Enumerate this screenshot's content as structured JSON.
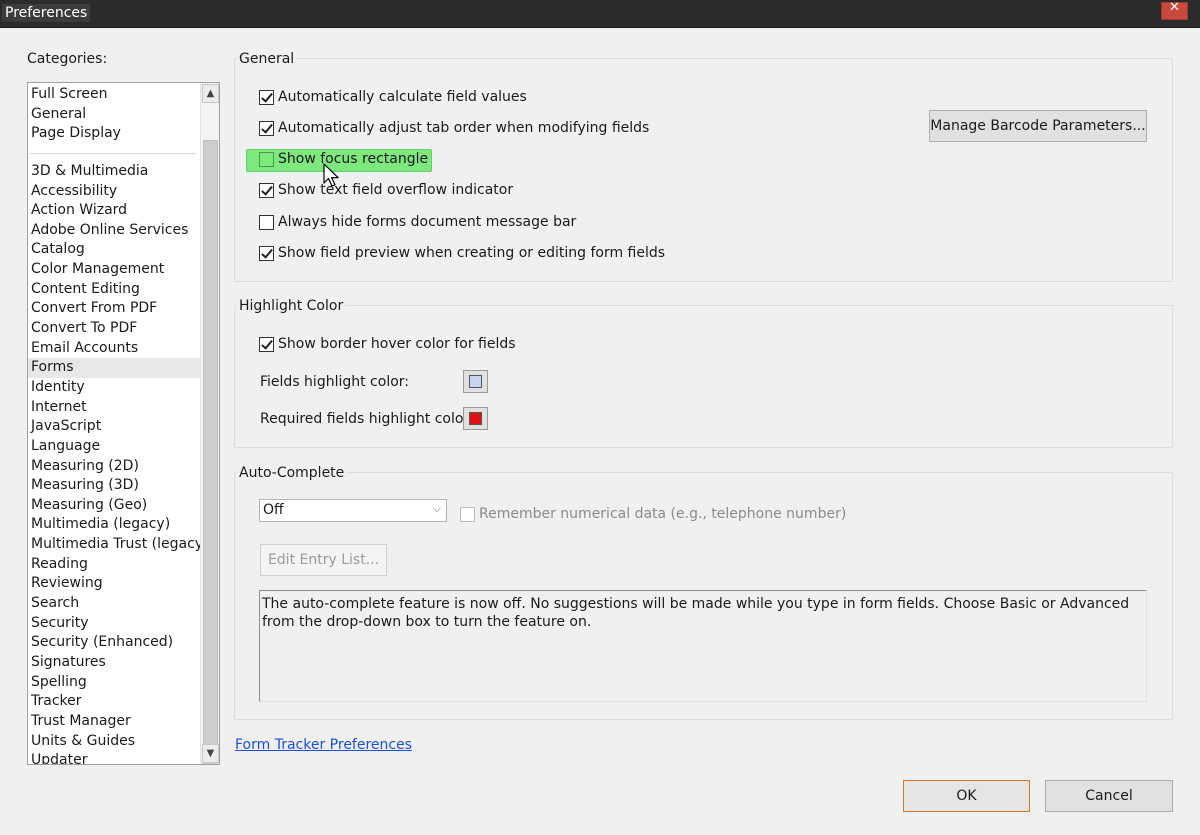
{
  "window": {
    "title": "Preferences",
    "close_glyph": "✕"
  },
  "categories": {
    "label": "Categories:",
    "top_items": [
      "Full Screen",
      "General",
      "Page Display"
    ],
    "items": [
      "3D & Multimedia",
      "Accessibility",
      "Action Wizard",
      "Adobe Online Services",
      "Catalog",
      "Color Management",
      "Content Editing",
      "Convert From PDF",
      "Convert To PDF",
      "Email Accounts",
      "Forms",
      "Identity",
      "Internet",
      "JavaScript",
      "Language",
      "Measuring (2D)",
      "Measuring (3D)",
      "Measuring (Geo)",
      "Multimedia (legacy)",
      "Multimedia Trust (legacy)",
      "Reading",
      "Reviewing",
      "Search",
      "Security",
      "Security (Enhanced)",
      "Signatures",
      "Spelling",
      "Tracker",
      "Trust Manager",
      "Units & Guides",
      "Updater"
    ],
    "selected": "Forms"
  },
  "general": {
    "title": "General",
    "options": [
      {
        "label": "Automatically calculate field values",
        "checked": true
      },
      {
        "label": "Automatically adjust tab order when modifying fields",
        "checked": true
      },
      {
        "label": "Show focus rectangle",
        "checked": false
      },
      {
        "label": "Show text field overflow indicator",
        "checked": true
      },
      {
        "label": "Always hide forms document message bar",
        "checked": false
      },
      {
        "label": "Show field preview when creating or editing form fields",
        "checked": true
      }
    ],
    "barcode_button": "Manage Barcode Parameters..."
  },
  "highlight": {
    "title": "Highlight Color",
    "hover_option": {
      "label": "Show border hover color for fields",
      "checked": true
    },
    "fields_label": "Fields highlight color:",
    "fields_color": "#c8d4f4",
    "required_label": "Required fields highlight color:",
    "required_color": "#e01010"
  },
  "autocomplete": {
    "title": "Auto-Complete",
    "mode": "Off",
    "remember_label": "Remember numerical data (e.g., telephone number)",
    "remember_checked": false,
    "edit_button": "Edit Entry List...",
    "description": "The auto-complete feature is now off. No suggestions will be made while you type in form fields. Choose Basic or Advanced from the drop-down box to turn the feature on."
  },
  "footer": {
    "link": "Form Tracker Preferences",
    "ok": "OK",
    "cancel": "Cancel"
  }
}
